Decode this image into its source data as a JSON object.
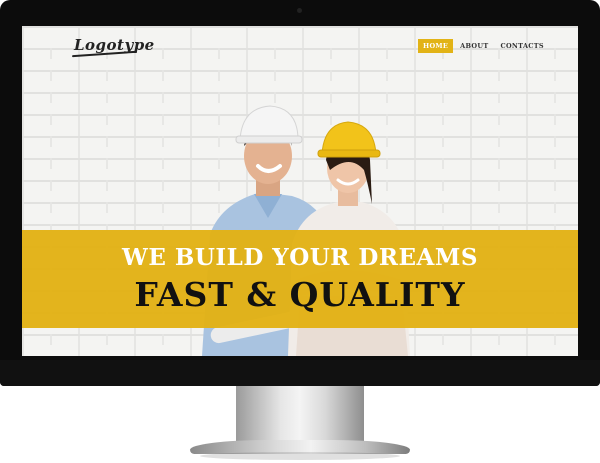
{
  "header": {
    "logo_text": "Logotype",
    "nav": [
      {
        "label": "HOME",
        "active": true
      },
      {
        "label": "ABOUT",
        "active": false
      },
      {
        "label": "CONTACTS",
        "active": false
      }
    ]
  },
  "hero": {
    "tagline": "WE BUILD YOUR DREAMS",
    "headline": "FAST & QUALITY"
  },
  "colors": {
    "accent": "#e2b316",
    "monitor_frame": "#0c0c0c",
    "helmet_yellow": "#f2c31a",
    "helmet_white": "#f5f5f5"
  }
}
